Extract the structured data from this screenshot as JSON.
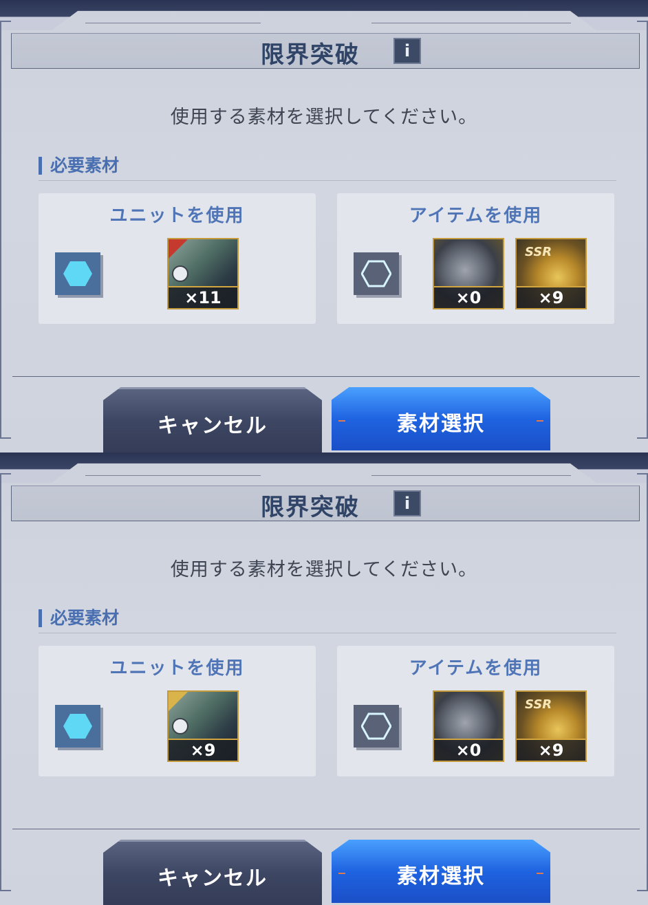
{
  "panels": [
    {
      "title": "限界突破",
      "info_icon": "i",
      "instruction": "使用する素材を選択してください。",
      "section_label": "必要素材",
      "unit_card": {
        "title": "ユニットを使用",
        "selected": true,
        "thumb": {
          "count": "×11",
          "badge": "attack"
        }
      },
      "item_card": {
        "title": "アイテムを使用",
        "selected": false,
        "items": [
          {
            "count": "×0",
            "type": "gear"
          },
          {
            "count": "×9",
            "type": "ssr",
            "label": "SSR"
          }
        ]
      },
      "buttons": {
        "cancel": "キャンセル",
        "confirm": "素材選択"
      }
    },
    {
      "title": "限界突破",
      "info_icon": "i",
      "instruction": "使用する素材を選択してください。",
      "section_label": "必要素材",
      "unit_card": {
        "title": "ユニットを使用",
        "selected": true,
        "thumb": {
          "count": "×9",
          "badge": "support"
        }
      },
      "item_card": {
        "title": "アイテムを使用",
        "selected": false,
        "items": [
          {
            "count": "×0",
            "type": "gear"
          },
          {
            "count": "×9",
            "type": "ssr",
            "label": "SSR"
          }
        ]
      },
      "buttons": {
        "cancel": "キャンセル",
        "confirm": "素材選択"
      }
    }
  ],
  "colors": {
    "accent": "#4f75b6",
    "confirm": "#1f63e0",
    "selected_hex": "#5fd8f5"
  }
}
